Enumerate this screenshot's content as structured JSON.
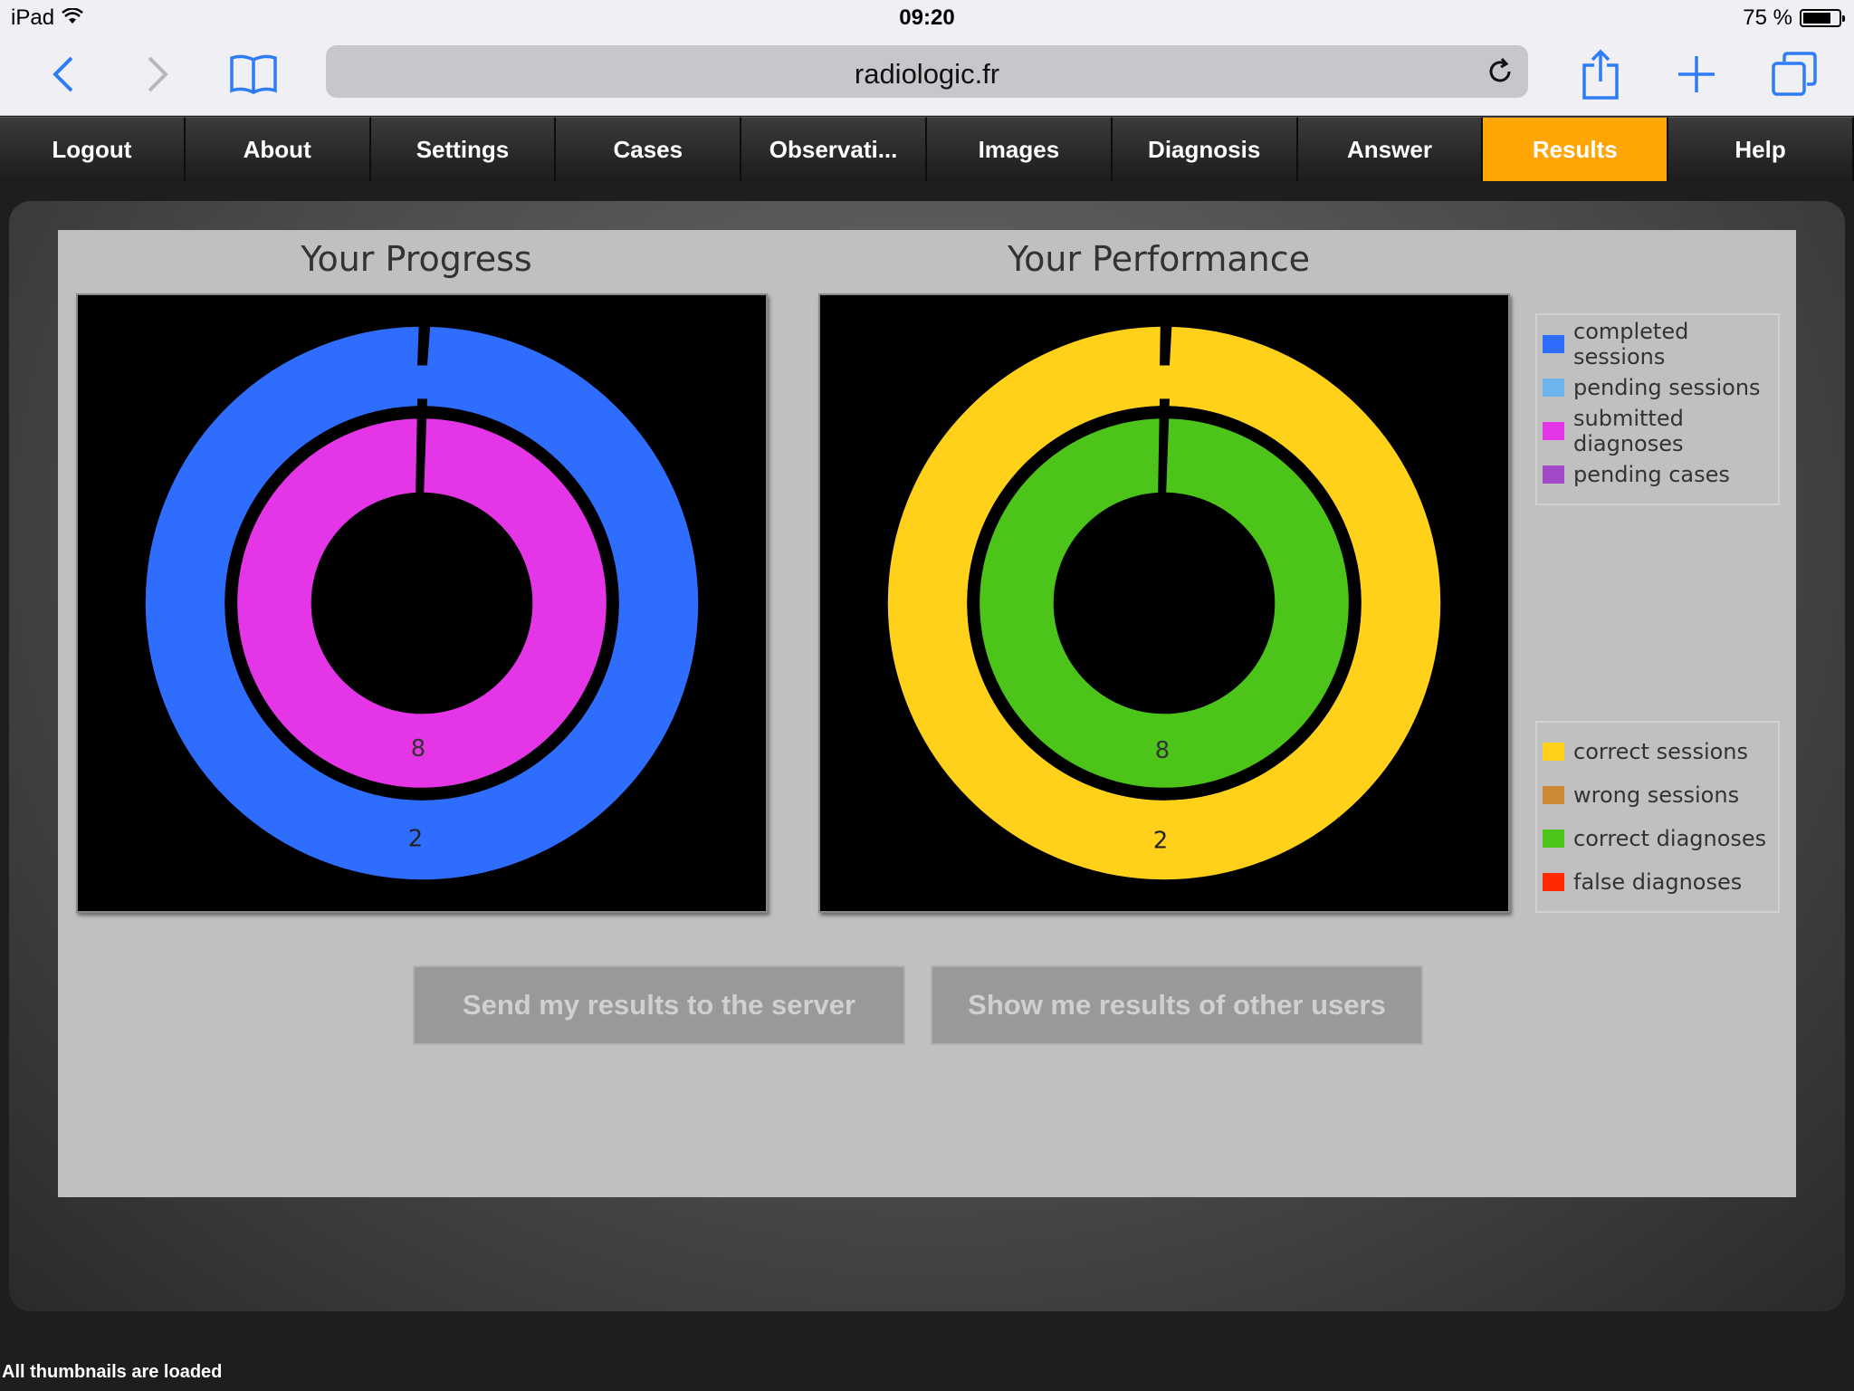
{
  "status_bar": {
    "device": "iPad",
    "time": "09:20",
    "battery": "75 %"
  },
  "browser": {
    "url": "radiologic.fr"
  },
  "nav": {
    "items": [
      "Logout",
      "About",
      "Settings",
      "Cases",
      "Observati...",
      "Images",
      "Diagnosis",
      "Answer",
      "Results",
      "Help"
    ],
    "active": "Results"
  },
  "progress": {
    "title": "Your Progress",
    "outer_label": "2",
    "inner_label": "8"
  },
  "performance": {
    "title": "Your Performance",
    "outer_label": "2",
    "inner_label": "8"
  },
  "legend_progress": [
    {
      "label": "completed sessions",
      "color": "#2f6dff"
    },
    {
      "label": "pending sessions",
      "color": "#6cb4ee"
    },
    {
      "label": "submitted diagnoses",
      "color": "#e436e6"
    },
    {
      "label": "pending cases",
      "color": "#a04ac8"
    }
  ],
  "legend_performance": [
    {
      "label": "correct sessions",
      "color": "#ffd11a"
    },
    {
      "label": "wrong sessions",
      "color": "#cc8833"
    },
    {
      "label": "correct diagnoses",
      "color": "#4cc41a"
    },
    {
      "label": "false diagnoses",
      "color": "#ff2a00"
    }
  ],
  "buttons": {
    "send": "Send my results to the server",
    "others": "Show me results of other users"
  },
  "footer": {
    "status": "All thumbnails are loaded"
  },
  "colors": {
    "active_tab": "#ffa505",
    "progress_outer": "#2f6dff",
    "progress_inner": "#e436e6",
    "performance_outer": "#ffd11a",
    "performance_inner": "#4cc41a"
  }
}
